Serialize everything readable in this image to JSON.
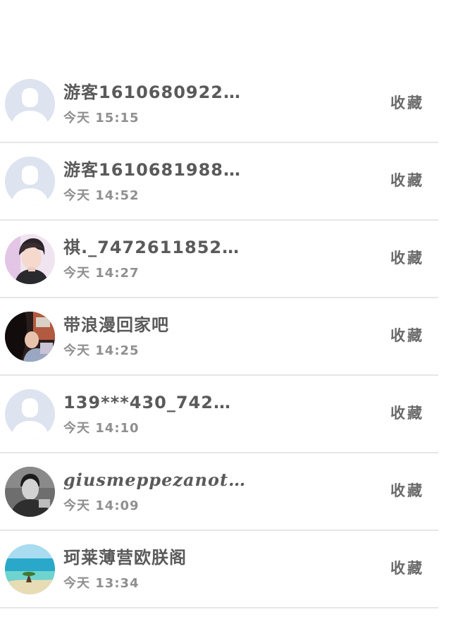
{
  "list": {
    "items": [
      {
        "name": "游客1610680922…",
        "time": "今天 15:15",
        "action": "收藏",
        "avatar": "default-user"
      },
      {
        "name": "游客1610681988…",
        "time": "今天 14:52",
        "action": "收藏",
        "avatar": "default-user"
      },
      {
        "name": "祺._7472611852…",
        "time": "今天 14:27",
        "action": "收藏",
        "avatar": "photo-person"
      },
      {
        "name": "带浪漫回家吧",
        "time": "今天 14:25",
        "action": "收藏",
        "avatar": "photo-person"
      },
      {
        "name": "139***430_742…",
        "time": "今天 14:10",
        "action": "收藏",
        "avatar": "default-user"
      },
      {
        "name": "giusmeppezanot…",
        "time": "今天 14:09",
        "action": "收藏",
        "avatar": "photo-person"
      },
      {
        "name": "珂莱薄营欧朕阁",
        "time": "今天 13:34",
        "action": "收藏",
        "avatar": "photo-landscape"
      }
    ]
  },
  "colors": {
    "name_text": "#5a5a5a",
    "time_text": "#8f8f8f",
    "action_text": "#6a6a6a",
    "divider": "#e6e6e9",
    "default_avatar_bg": "#dde3ef"
  }
}
